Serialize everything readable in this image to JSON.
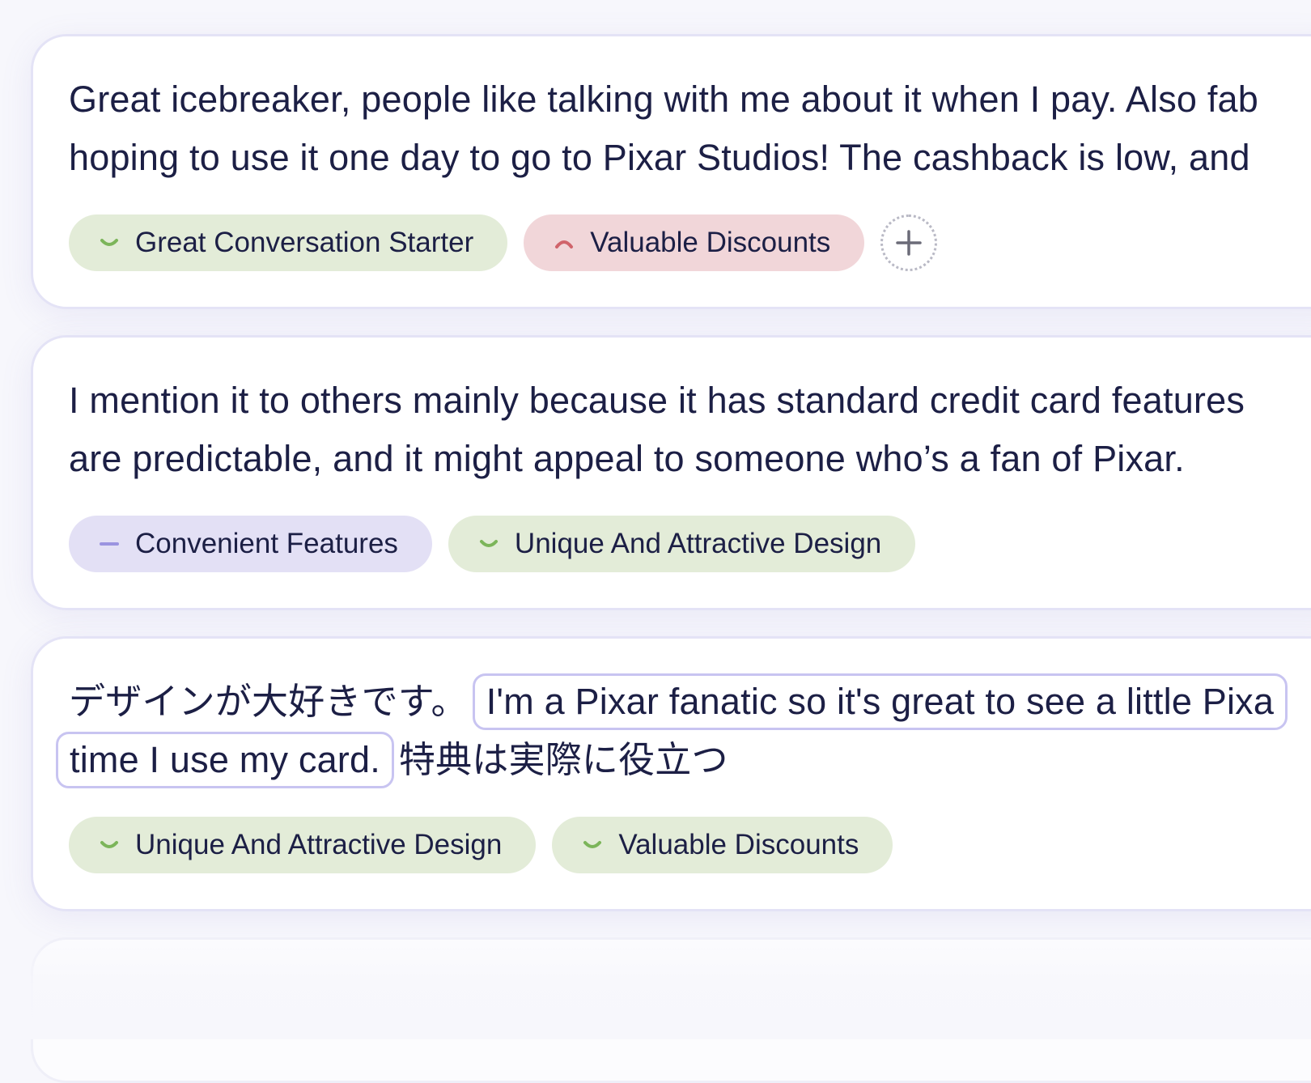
{
  "reviews": [
    {
      "lines": [
        "Great icebreaker, people like talking with me about it when I pay. Also fab",
        "hoping to use it one day to go to Pixar Studios! The cashback is low, and"
      ],
      "tags": [
        {
          "label": "Great Conversation Starter",
          "sentiment": "positive",
          "icon": "smile-icon"
        },
        {
          "label": "Valuable Discounts",
          "sentiment": "negative",
          "icon": "frown-icon"
        }
      ],
      "add_tag_icon": "plus-icon"
    },
    {
      "lines": [
        "I mention it to others mainly because it has standard credit card features",
        "are predictable, and it might appeal to someone who’s a fan of Pixar."
      ],
      "tags": [
        {
          "label": "Convenient Features",
          "sentiment": "neutral",
          "icon": "dash-icon"
        },
        {
          "label": "Unique And Attractive Design",
          "sentiment": "positive",
          "icon": "smile-icon"
        }
      ]
    },
    {
      "original_part_1": "デザインが大好きです。",
      "translation_line_1": "I'm a Pixar fanatic so it's great to see a little Pixa",
      "translation_line_2": "time I use my card.",
      "original_part_2": "特典は実際に役立つ",
      "tags": [
        {
          "label": "Unique And Attractive Design",
          "sentiment": "positive",
          "icon": "smile-icon"
        },
        {
          "label": "Valuable Discounts",
          "sentiment": "positive",
          "icon": "smile-icon"
        }
      ]
    }
  ],
  "colors": {
    "positive_bg": "#e3ecd8",
    "positive_icon": "#7cb55a",
    "negative_bg": "#f1d6d9",
    "negative_icon": "#d0646b",
    "neutral_bg": "#e3e0f5",
    "neutral_icon": "#9b94e0",
    "text": "#1c1f45",
    "highlight_border": "#c8c4f1"
  }
}
